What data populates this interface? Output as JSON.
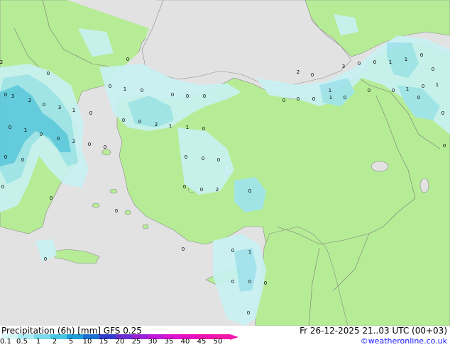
{
  "footer": {
    "title": "Precipitation (6h) [mm] GFS 0.25",
    "datetime": "Fr 26-12-2025 21..03 UTC (00+03)",
    "credit": "©weatheronline.co.uk"
  },
  "legend": {
    "labels": [
      "0.1",
      "0.5",
      "1",
      "2",
      "5",
      "10",
      "15",
      "20",
      "25",
      "30",
      "35",
      "40",
      "45",
      "50"
    ],
    "colors": [
      "#d7f7f7",
      "#a6ecf2",
      "#7ad9ea",
      "#48c5e3",
      "#1e9fd8",
      "#1a6fd0",
      "#2f3ccc",
      "#6a2fd0",
      "#9a22d6",
      "#c018d8",
      "#dc12d0",
      "#e60ec0",
      "#f010b0",
      "#f418a8"
    ]
  },
  "colors": {
    "land": "#b6ec96",
    "sea": "#e2e2e2",
    "precip_light": "#c8f2f4",
    "precip_mid": "#9ee4ee",
    "precip_heavy": "#5cc8e4"
  },
  "map_labels": [
    "2",
    "0",
    "0",
    "3",
    "2",
    "0",
    "3",
    "1",
    "0",
    "0",
    "1",
    "0",
    "0",
    "0",
    "0",
    "0",
    "0",
    "2",
    "1",
    "1",
    "0",
    "0",
    "1",
    "0",
    "0",
    "2",
    "0",
    "0",
    "0",
    "0",
    "0",
    "0",
    "0",
    "0",
    "0",
    "2",
    "0",
    "0",
    "0",
    "0",
    "0",
    "0",
    "0",
    "0",
    "1",
    "0",
    "3",
    "0",
    "0",
    "1",
    "1",
    "0",
    "0",
    "1",
    "0",
    "1",
    "0",
    "0",
    "0",
    "0",
    "1",
    "0",
    "0",
    "0",
    "0",
    "0",
    "2",
    "0",
    "1",
    "0",
    "0",
    "0"
  ]
}
